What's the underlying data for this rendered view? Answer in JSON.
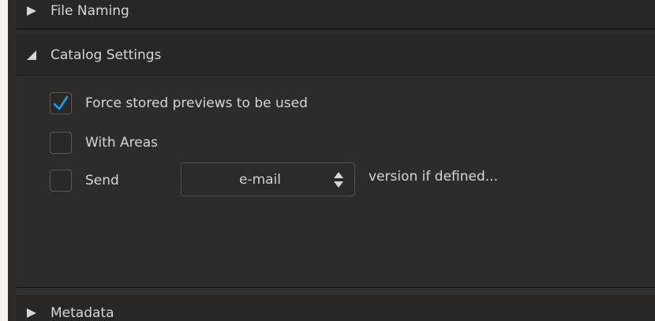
{
  "sections": {
    "file_naming": {
      "title": "File Naming",
      "expanded": false
    },
    "catalog_settings": {
      "title": "Catalog Settings",
      "expanded": true,
      "options": [
        {
          "label": "Force stored previews to be used",
          "checked": true
        },
        {
          "label": "With Areas",
          "checked": false
        },
        {
          "label": "Send",
          "checked": false
        }
      ],
      "send": {
        "selected": "e-mail",
        "suffix": "version if defined..."
      }
    },
    "metadata": {
      "title": "Metadata",
      "expanded": false
    }
  },
  "colors": {
    "accent_check": "#1a9cf0",
    "panel_bg": "#2c2b29",
    "text": "#d6d6d6"
  },
  "icons": {
    "collapsed": "triangle-right-icon",
    "expanded": "triangle-down-icon",
    "check": "checkmark-icon",
    "stepper": "up-down-arrows-icon"
  }
}
